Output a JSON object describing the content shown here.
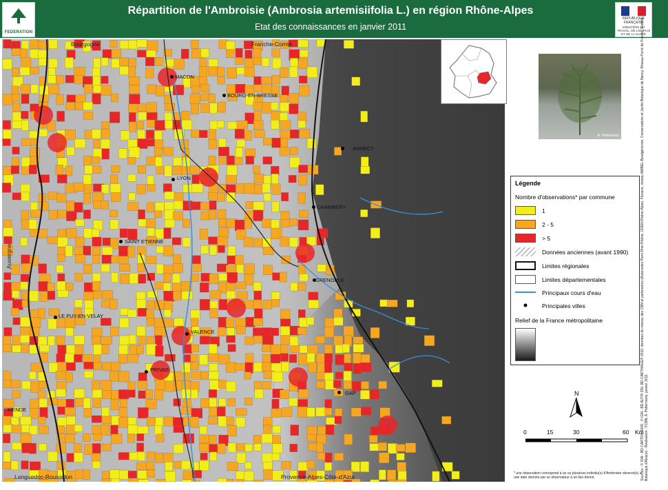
{
  "header": {
    "title": "Répartition de l'Ambroisie (Ambrosia artemisiifolia L.) en région Rhône-Alpes",
    "subtitle": "Etat des connaissances en janvier 2011",
    "logo_left_text": "FEDERATION",
    "logo_right_rf": "RÉPUBLIQUE FRANÇAISE",
    "logo_right_ministry": "MINISTÈRE DU TRAVAIL, DE L'EMPLOI ET DE LA SANTÉ",
    "colors": {
      "header_bg": "#1a6b3d",
      "title_text": "#ffffff"
    }
  },
  "map": {
    "region_labels": [
      "Bourgogne",
      "Franche-Comté",
      "Auvergne",
      "Languedoc-Roussillon",
      "Provence-Alpes-Côte-d'Azur"
    ],
    "cities": [
      "MACON",
      "BOURG-EN-BRESSE",
      "ANNECY",
      "LYON",
      "CHAMBERY",
      "SAINT ETIENNE",
      "GRENOBLE",
      "LE PUY-EN-VELAY",
      "VALENCE",
      "PRIVAS",
      "GAP",
      "MENDE"
    ],
    "colors": {
      "one": "#f2ee1c",
      "two_to_five": "#f5a623",
      "more_than_five": "#e8262a",
      "relief_light": "#d8d8d8",
      "relief_dark": "#2a2a2a",
      "rivers": "#3d8fd6"
    }
  },
  "photo": {
    "credit": "A. Peltermans"
  },
  "legend": {
    "title": "Légende",
    "subtitle": "Nombre d'observations* par commune",
    "items": [
      {
        "label": "1",
        "color": "#f2ee1c"
      },
      {
        "label": "2 - 5",
        "color": "#f5a623"
      },
      {
        "label": "> 5",
        "color": "#e8262a"
      },
      {
        "label": "Données anciennes (avant 1990)"
      },
      {
        "label": "Limites régionales"
      },
      {
        "label": "Limites départementales"
      },
      {
        "label": "Principaux cours d'eau"
      },
      {
        "label": "Principales villes"
      }
    ],
    "relief_label": "Relief de la France métropolitaine"
  },
  "north_label": "N",
  "scale": {
    "ticks": [
      "0",
      "15",
      "30",
      "60"
    ],
    "unit": "Km"
  },
  "footnote": "* une observation correspond à un ou plusieurs individu(s) d'Ambroisie observé(s) à une date donnée par un observateur à un lieu donné.",
  "sources": "Sources : © IGN - BD CARTO® 2009 , © IGN - BD ALTI® 250, BD CARTHAGE® 2010, données du réseau des CBN et partenaires (Autoroutes Paris Rhin Rhône, CREN Rhône-Alpes, Floraine, réseau AMBEL-Bioalgérienne, Conservatoire et Jardin Botanique de Nancy, Réseau Ferré de France, Société Botanique d'Alsace) - Réalisation : FCBN, A. Peltermans, janvier 2011"
}
